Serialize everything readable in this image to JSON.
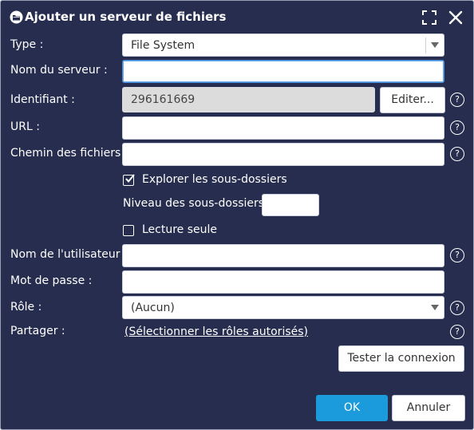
{
  "dialog": {
    "title": "Ajouter un serveur de fichiers",
    "icons": {
      "title": "server-folder-icon",
      "maximize": "maximize-icon",
      "close": "close-icon"
    }
  },
  "form": {
    "type": {
      "label": "Type :",
      "value": "File System"
    },
    "server_name": {
      "label": "Nom du serveur :",
      "value": ""
    },
    "identifier": {
      "label": "Identifiant :",
      "value": "296161669",
      "edit_button": "Editer..."
    },
    "url": {
      "label": "URL :",
      "value": ""
    },
    "file_path": {
      "label": "Chemin des fichiers :",
      "value": ""
    },
    "explore_subfolders": {
      "label": "Explorer les sous-dossiers",
      "checked": true
    },
    "subfolder_level": {
      "label": "Niveau des sous-dossiers:",
      "value": ""
    },
    "read_only": {
      "label": "Lecture seule",
      "checked": false
    },
    "username": {
      "label": "Nom de l'utilisateur :",
      "value": ""
    },
    "password": {
      "label": "Mot de passe :",
      "value": ""
    },
    "role": {
      "label": "Rôle :",
      "value": "(Aucun)"
    },
    "share": {
      "label": "Partager :",
      "link": "(Sélectionner les rôles autorisés)"
    },
    "help_symbol": "?"
  },
  "buttons": {
    "test_connection": "Tester la connexion",
    "ok": "OK",
    "cancel": "Annuler"
  },
  "colors": {
    "background": "#262d4e",
    "primary": "#1b9bdb",
    "focus": "#4a90d9"
  }
}
